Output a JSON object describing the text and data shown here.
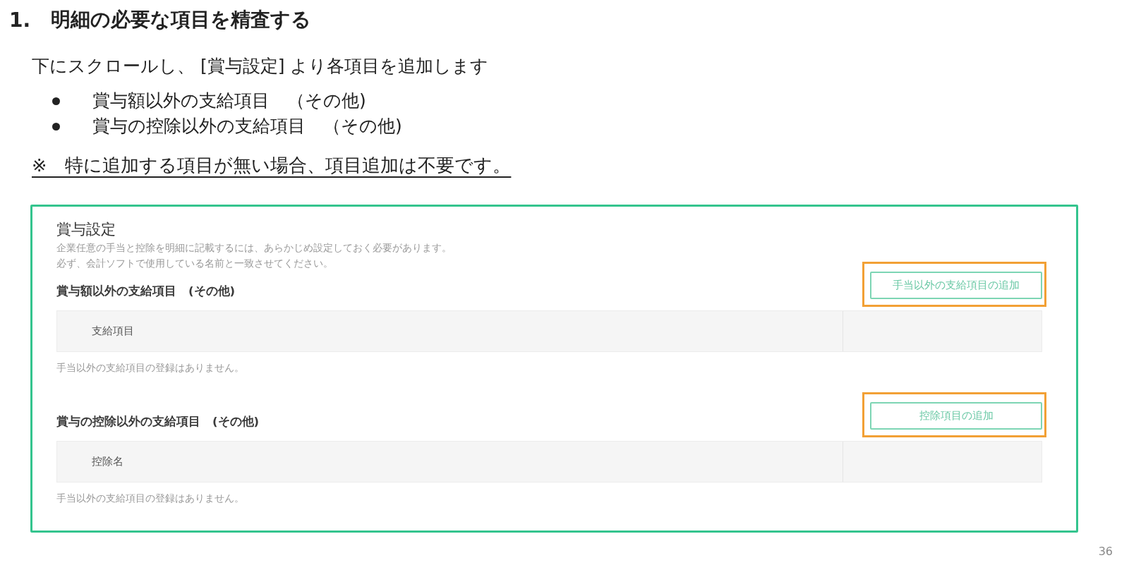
{
  "heading": {
    "number": "1.",
    "title": "明細の必要な項目を精査する"
  },
  "intro": "下にスクロールし、 [賞与設定] より各項目を追加します",
  "bullets": [
    "賞与額以外の支給項目　（その他)",
    "賞与の控除以外の支給項目　（その他)"
  ],
  "note": "※　特に追加する項目が無い場合、項目追加は不要です。",
  "screenshot": {
    "title": "賞与設定",
    "description": [
      "企業任意の手当と控除を明細に記載するには、あらかじめ設定しておく必要があります。",
      "必ず、会計ソフトで使用している名前と一致させてください。"
    ],
    "sections": [
      {
        "heading": "賞与額以外の支給項目　(その他)",
        "button": {
          "label": "手当以外の支給項目の追加",
          "highlighted": true
        },
        "columns": [
          "支給項目"
        ],
        "empty_message": "手当以外の支給項目の登録はありません。"
      },
      {
        "heading": "賞与の控除以外の支給項目　(その他)",
        "button": {
          "label": "控除項目の追加",
          "highlighted": true
        },
        "columns": [
          "控除名"
        ],
        "empty_message": "手当以外の支給項目の登録はありません。"
      }
    ]
  },
  "page_number": "36"
}
